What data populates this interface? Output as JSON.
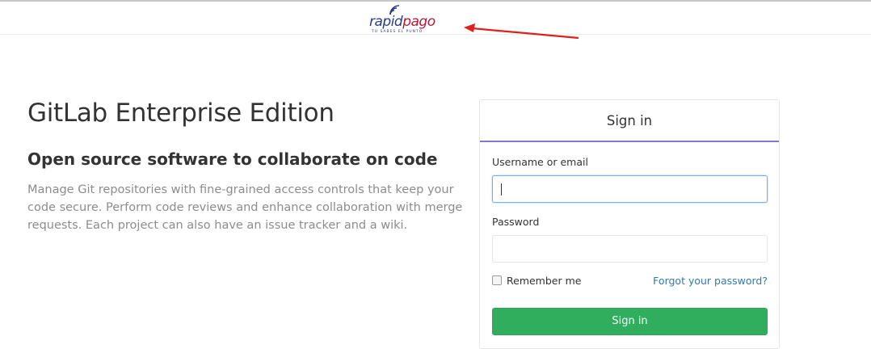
{
  "header": {
    "logo": {
      "word_first": "rapid",
      "word_second": "pago",
      "tagline": "TU SABES EL PUNTO"
    }
  },
  "main": {
    "title": "GitLab Enterprise Edition",
    "subtitle": "Open source software to collaborate on code",
    "description": "Manage Git repositories with fine-grained access controls that keep your code secure. Perform code reviews and enhance collaboration with merge requests. Each project can also have an issue tracker and a wiki."
  },
  "signin": {
    "tab_label": "Sign in",
    "username_label": "Username or email",
    "username_value": "",
    "password_label": "Password",
    "password_value": "",
    "remember_label": "Remember me",
    "remember_checked": false,
    "forgot_link": "Forgot your password?",
    "submit_label": "Sign in"
  },
  "colors": {
    "tab_underline": "#7d7ac9",
    "primary_button": "#31ad5e",
    "link": "#3777b0",
    "logo_blue": "#2a3a8c",
    "logo_red": "#b5193a",
    "annotation_arrow": "#e0201a"
  },
  "icons": {
    "logo_signal": "wifi-signal-icon",
    "annotation": "red-arrow-icon"
  }
}
